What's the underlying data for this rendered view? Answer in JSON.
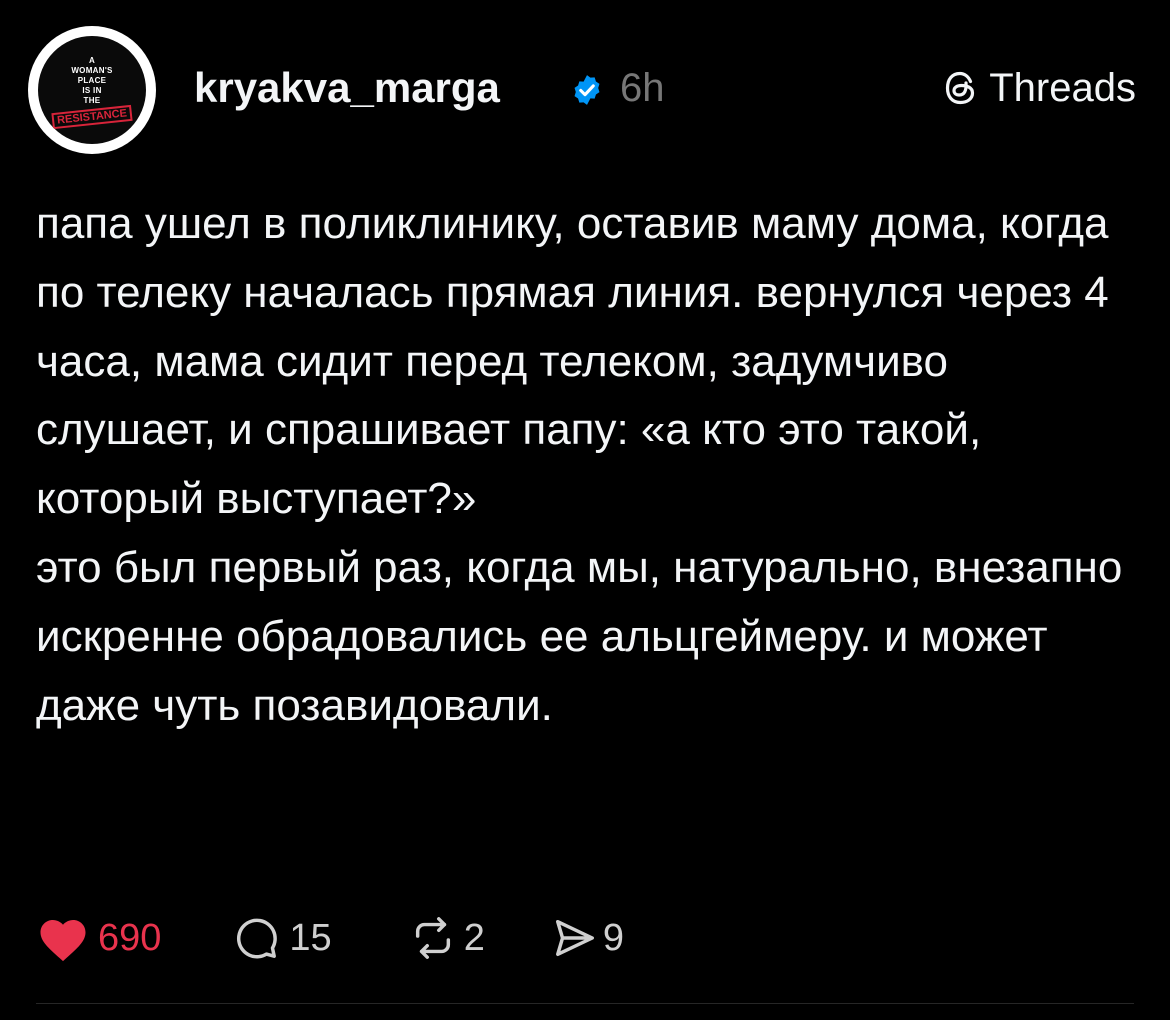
{
  "header": {
    "avatar_text_lines": [
      "A",
      "WOMAN'S",
      "PLACE",
      "IS IN",
      "THE"
    ],
    "avatar_stamp": "RESISTANCE",
    "username": "kryakva_marga",
    "verified_icon": "verified-badge-icon",
    "timestamp": "6h",
    "brand_label": "Threads",
    "brand_icon": "threads-logo-icon"
  },
  "post": {
    "paragraphs": [
      "папа ушел в поликлинику, оставив маму дома, когда по телеку началась прямая линия. вернулся через 4 часа, мама сидит перед телеком, задумчиво слушает, и спрашивает папу: «а кто это такой, который выступает?»",
      "это был первый раз, когда мы, натурально, внезапно искренне обрадовались ее альцгеймеру. и может даже чуть позавидовали."
    ]
  },
  "actions": {
    "likes": "690",
    "replies": "15",
    "reposts": "2",
    "shares": "9"
  },
  "colors": {
    "background": "#000000",
    "text": "#f3f5f7",
    "muted": "#777777",
    "like": "#e9334d",
    "verified": "#0095f6"
  }
}
